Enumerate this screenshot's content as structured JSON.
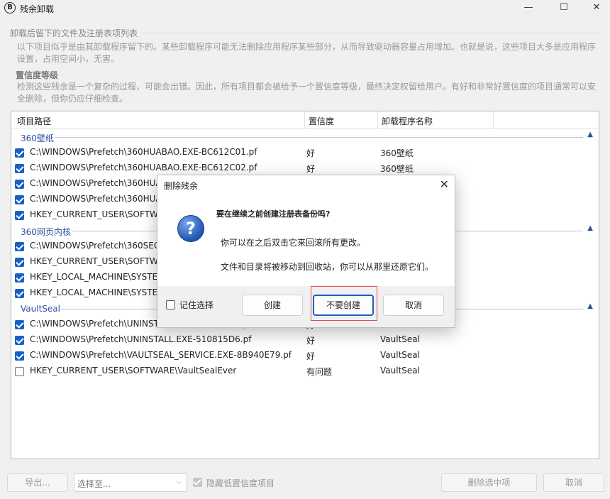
{
  "window": {
    "title": "残余卸载",
    "app_icon_glyph": "B",
    "minimize_glyph": "—",
    "maximize_glyph": "☐",
    "close_glyph": "✕"
  },
  "info": {
    "group_title": "卸载后留下的文件及注册表项列表",
    "intro_text": "以下项目似乎是由其卸载程序留下的。某些卸载程序可能无法删除应用程序某些部分，从而导致驱动器容量占用增加。也就是说，这些项目大多是应用程序设置，占用空间小，无害。",
    "confidence_title": "置信度等级",
    "confidence_text": "检测这些残余是一个复杂的过程，可能会出错。因此，所有项目都会被给予一个置信度等级，最终决定权留给用户。有好和非常好置信度的项目通常可以安全删除，但你仍应仔细检查。"
  },
  "list": {
    "headers": {
      "path": "项目路径",
      "confidence": "置信度",
      "program": "卸载程序名称"
    },
    "sort_indicator": "^",
    "groups": [
      {
        "name": "360壁纸",
        "items": [
          {
            "checked": true,
            "path": "C:\\WINDOWS\\Prefetch\\360HUABAO.EXE-BC612C01.pf",
            "confidence": "好",
            "program": "360壁纸"
          },
          {
            "checked": true,
            "path": "C:\\WINDOWS\\Prefetch\\360HUABAO.EXE-BC612C02.pf",
            "confidence": "好",
            "program": "360壁纸"
          },
          {
            "checked": true,
            "path": "C:\\WINDOWS\\Prefetch\\360HUA",
            "confidence": "",
            "program": ""
          },
          {
            "checked": true,
            "path": "C:\\WINDOWS\\Prefetch\\360HUA",
            "confidence": "",
            "program": ""
          },
          {
            "checked": true,
            "path": "HKEY_CURRENT_USER\\SOFTWA",
            "confidence": "",
            "program": ""
          }
        ]
      },
      {
        "name": "360网页内核",
        "items": [
          {
            "checked": true,
            "path": "C:\\WINDOWS\\Prefetch\\360SEC",
            "confidence": "",
            "program": ""
          },
          {
            "checked": true,
            "path": "HKEY_CURRENT_USER\\SOFTWA",
            "confidence": "",
            "program": ""
          },
          {
            "checked": true,
            "path": "HKEY_LOCAL_MACHINE\\SYSTEM",
            "confidence": "",
            "program": ""
          },
          {
            "checked": true,
            "path": "HKEY_LOCAL_MACHINE\\SYSTEM",
            "confidence": "",
            "program": ""
          }
        ]
      },
      {
        "name": "VaultSeal",
        "items": [
          {
            "checked": true,
            "path": "C:\\WINDOWS\\Prefetch\\UNINSTALL.EXE-3C69C0BA.pf",
            "confidence": "好",
            "program": "VaultSeal"
          },
          {
            "checked": true,
            "path": "C:\\WINDOWS\\Prefetch\\UNINSTALL.EXE-510815D6.pf",
            "confidence": "好",
            "program": "VaultSeal"
          },
          {
            "checked": true,
            "path": "C:\\WINDOWS\\Prefetch\\VAULTSEAL_SERVICE.EXE-8B940E79.pf",
            "confidence": "好",
            "program": "VaultSeal"
          },
          {
            "checked": false,
            "path": "HKEY_CURRENT_USER\\SOFTWARE\\VaultSealEver",
            "confidence": "有问题",
            "program": "VaultSeal"
          }
        ]
      }
    ]
  },
  "footer": {
    "export_label": "导出...",
    "select_value": "选择至...",
    "hide_low_label": "隐藏低置信度项目",
    "hide_low_checked": true,
    "delete_label": "删除选中项",
    "cancel_label": "取消"
  },
  "dialog": {
    "title": "删除残余",
    "close_glyph": "✕",
    "icon_glyph": "?",
    "heading": "要在继续之前创建注册表备份吗?",
    "line1": "你可以在之后双击它来回滚所有更改。",
    "line2": "文件和目录将被移动到回收站，你可以从那里还原它们。",
    "remember_label": "记住选择",
    "remember_checked": false,
    "create_label": "创建",
    "dont_create_label": "不要创建",
    "cancel_label": "取消"
  }
}
